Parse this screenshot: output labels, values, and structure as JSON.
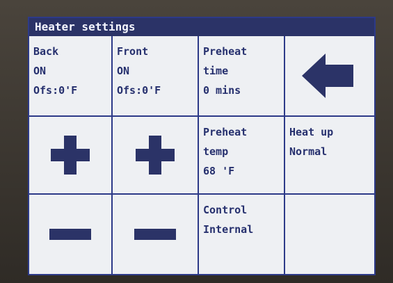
{
  "screen": {
    "title": "Heater settings"
  },
  "back_zone": {
    "label": "Back",
    "state": "ON",
    "offset": "Ofs:0'F"
  },
  "front_zone": {
    "label": "Front",
    "state": "ON",
    "offset": "Ofs:0'F"
  },
  "preheat_time": {
    "label_line1": "Preheat",
    "label_line2": "time",
    "value": "0 mins"
  },
  "preheat_temp": {
    "label_line1": "Preheat",
    "label_line2": "temp",
    "value": "68 'F"
  },
  "heat_up": {
    "label": "Heat up",
    "value": "Normal"
  },
  "control": {
    "label": "Control",
    "value": "Internal"
  },
  "colors": {
    "accent": "#2b3367",
    "grid_lines": "#2d3a88",
    "screen_bg": "#eef0f3",
    "text": "#26306e"
  },
  "icons": {
    "back": "arrow-left-icon",
    "plus": "plus-icon",
    "minus": "minus-icon"
  }
}
